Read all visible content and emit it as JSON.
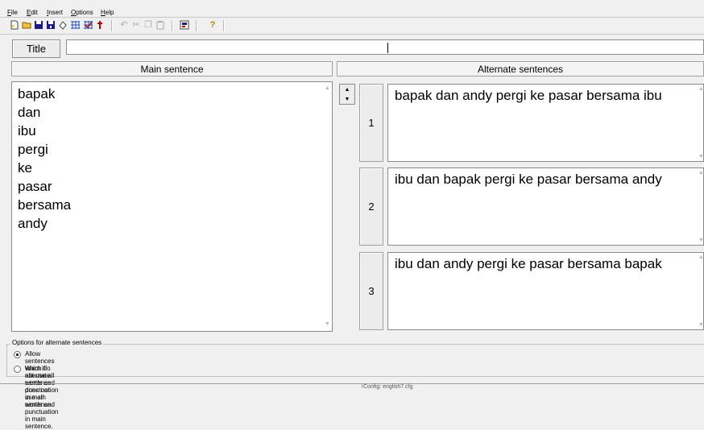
{
  "menu": [
    "File",
    "Edit",
    "Insert",
    "Options",
    "Help"
  ],
  "toolbar": {
    "icons": [
      "new-document-icon",
      "open-folder-icon",
      "save-icon",
      "save-as-icon",
      "erase-icon",
      "grid-icon",
      "grid-check-icon",
      "red-pin-icon",
      "undo-icon",
      "cut-icon",
      "copy-icon",
      "paste-icon",
      "properties-icon",
      "help-icon"
    ]
  },
  "title": {
    "button_label": "Title",
    "value": ""
  },
  "main": {
    "header": "Main sentence",
    "words": [
      "bapak",
      "dan",
      "ibu",
      "pergi",
      "ke",
      "pasar",
      "bersama",
      "andy"
    ]
  },
  "alternates": {
    "header": "Alternate sentences",
    "items": [
      {
        "number": "1",
        "text": "bapak dan andy pergi ke pasar bersama ibu"
      },
      {
        "number": "2",
        "text": "ibu dan bapak pergi ke pasar bersama andy"
      },
      {
        "number": "3",
        "text": "ibu dan andy pergi ke pasar bersama bapak"
      }
    ]
  },
  "options": {
    "legend": "Options for alternate sentences",
    "radio1": "Allow sentences which do not use all words and punctuation in main sentence.",
    "radio2": "Warn if alternate sentence does not use all words and punctuation in main sentence.",
    "selected": 1
  },
  "status": {
    "text": "Config: english7.cfg"
  },
  "colors": {
    "background": "#f0f0f0",
    "field": "#ffffff",
    "border": "#8a8a8a"
  }
}
